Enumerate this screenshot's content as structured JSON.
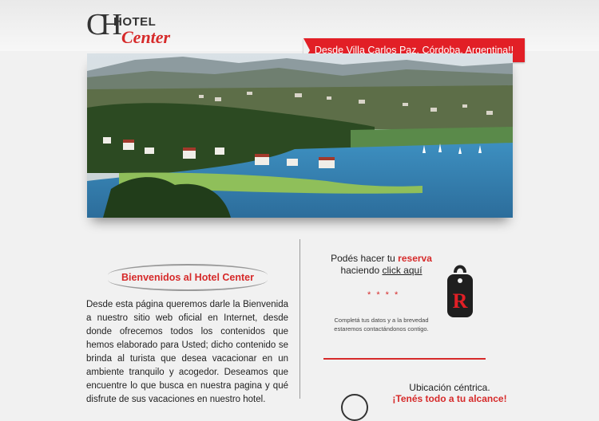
{
  "header": {
    "logo_monogram": "CH",
    "logo_hotel": "HOTEL",
    "logo_center": "Center",
    "ribbon_text": "Desde Villa Carlos Paz, Córdoba, Argentina!!"
  },
  "welcome": {
    "title": "Bienvenidos al Hotel Center",
    "text": "Desde esta página queremos darle la Bienvenida a nuestro sitio web oficial en Internet, desde donde ofrecemos todos los contenidos que hemos elaborado para Usted; dicho contenido se brinda al turista que desea vacacionar en un ambiente tranquilo y acogedor. Deseamos que encuentre lo que busca en nuestra pagina y qué disfrute de sus vacaciones en nuestro hotel."
  },
  "reserve": {
    "line1_prefix": "Podés hacer tu",
    "line1_highlight": "reserva",
    "line2_prefix": "haciendo",
    "line2_link": "click aquí",
    "stars": "* * * *",
    "note": "Completá tus datos y a la brevedad estaremos contactándonos contigo.",
    "tag_letter": "R"
  },
  "location": {
    "line1": "Ubicación céntrica.",
    "line2": "¡Tenés todo a tu alcance!"
  },
  "colors": {
    "accent": "#e21f26",
    "text": "#222222",
    "background": "#f1f1f1"
  }
}
